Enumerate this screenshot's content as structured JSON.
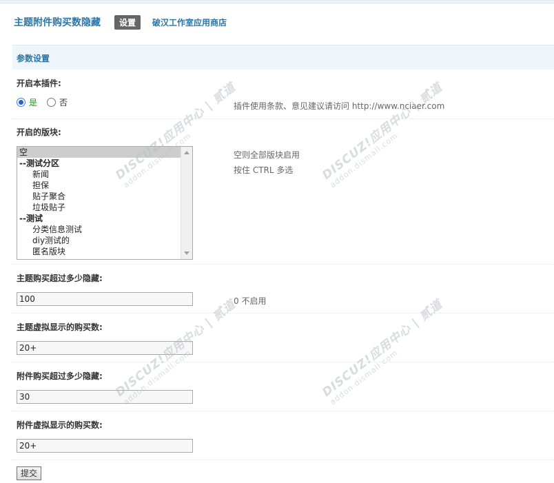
{
  "header": {
    "title": "主题附件购买数隐藏",
    "settings_button": "设置",
    "shop_link": "破汉工作室应用商店"
  },
  "section": {
    "title": "参数设置"
  },
  "fields": {
    "enable": {
      "label": "开启本插件:",
      "yes": "是",
      "no": "否",
      "selected": "是",
      "hint": "插件使用条款、意见建议请访问 http://www.nciaer.com"
    },
    "forums": {
      "label": "开启的版块:",
      "options": [
        {
          "text": "空",
          "selected": true
        },
        {
          "text": "--测试分区",
          "group": true
        },
        {
          "text": "新闻"
        },
        {
          "text": "担保"
        },
        {
          "text": "贴子聚合"
        },
        {
          "text": "垃圾贴子"
        },
        {
          "text": "--测试",
          "group": true
        },
        {
          "text": "分类信息测试"
        },
        {
          "text": "diy测试的"
        },
        {
          "text": "匿名版块"
        }
      ],
      "hint_line1": "空则全部版块启用",
      "hint_line2": "按住 CTRL 多选"
    },
    "thread_hide": {
      "label": "主题购买超过多少隐藏:",
      "value": "100",
      "hint": "0 不启用"
    },
    "thread_virtual": {
      "label": "主题虚拟显示的购买数:",
      "value": "20+"
    },
    "attach_hide": {
      "label": "附件购买超过多少隐藏:",
      "value": "30"
    },
    "attach_virtual": {
      "label": "附件虚拟显示的购买数:",
      "value": "20+"
    }
  },
  "submit_label": "提交",
  "watermark": {
    "line1": "DISCUZ!应用中心 | 贰道",
    "line2": "addon.dismall.com"
  }
}
